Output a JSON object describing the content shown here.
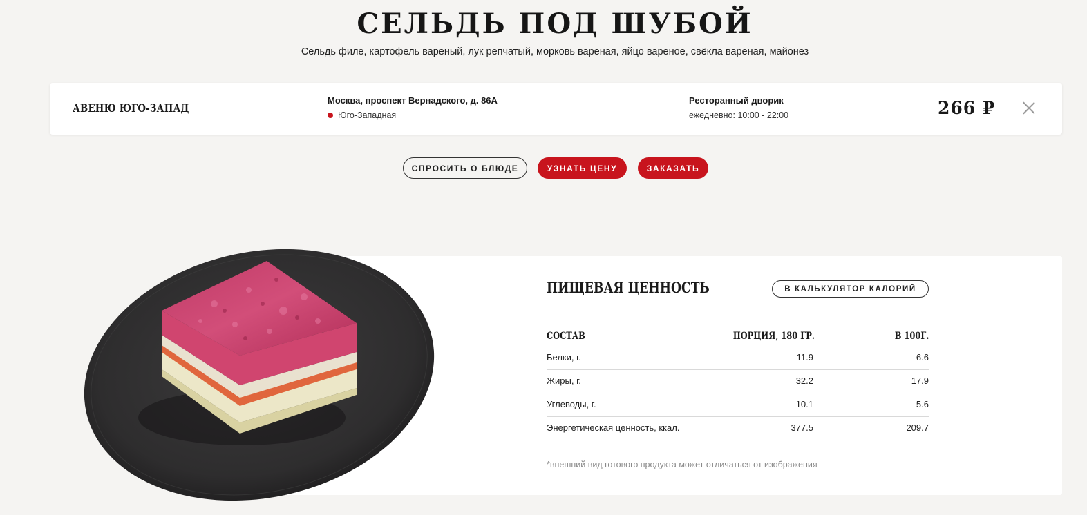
{
  "dish": {
    "title": "СЕЛЬДЬ ПОД ШУБОЙ",
    "ingredients": "Сельдь филе, картофель вареный, лук репчатый, морковь вареная, яйцо вареное, свёкла вареная, майонез"
  },
  "store": {
    "name": "АВЕНЮ ЮГО-ЗАПАД",
    "address": "Москва, проспект Вернадского, д. 86А",
    "metro": "Юго-Западная",
    "metro_color": "#c8141d",
    "location": "Ресторанный дворик",
    "hours": "ежедневно: 10:00 - 22:00",
    "price": "266 ₽",
    "close_icon": "close-icon"
  },
  "actions": {
    "ask": "СПРОСИТЬ О БЛЮДЕ",
    "price": "УЗНАТЬ ЦЕНУ",
    "order": "ЗАКАЗАТЬ",
    "accent_color": "#c8141d"
  },
  "nutrition": {
    "title": "ПИЩЕВАЯ ЦЕННОСТЬ",
    "calculator_button": "В КАЛЬКУЛЯТОР КАЛОРИЙ",
    "headers": [
      "СОСТАВ",
      "ПОРЦИЯ, 180 ГР.",
      "В 100Г."
    ],
    "rows": [
      [
        "Белки, г.",
        "11.9",
        "6.6"
      ],
      [
        "Жиры, г.",
        "32.2",
        "17.9"
      ],
      [
        "Углеводы, г.",
        "10.1",
        "5.6"
      ],
      [
        "Энергетическая ценность, ккал.",
        "377.5",
        "209.7"
      ]
    ],
    "disclaimer": "*внешний вид готового продукта может отличаться от изображения"
  }
}
